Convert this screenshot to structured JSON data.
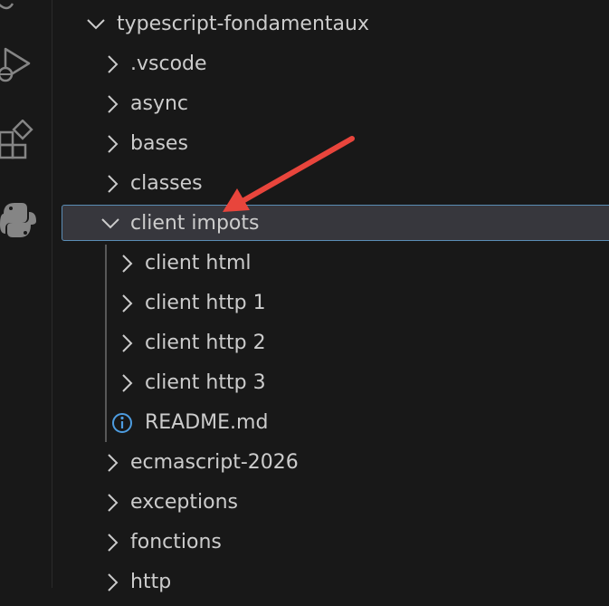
{
  "explorer": {
    "root": {
      "label": "typescript-fondamentaux",
      "expanded": true
    },
    "items": [
      {
        "label": ".vscode",
        "expanded": false
      },
      {
        "label": "async",
        "expanded": false
      },
      {
        "label": "bases",
        "expanded": false
      },
      {
        "label": "classes",
        "expanded": false
      },
      {
        "label": "client impots",
        "expanded": true,
        "selected": true
      },
      {
        "label": "client html",
        "expanded": false
      },
      {
        "label": "client http 1",
        "expanded": false
      },
      {
        "label": "client http 2",
        "expanded": false
      },
      {
        "label": "client http 3",
        "expanded": false
      },
      {
        "label": "README.md",
        "icon": "info-icon"
      },
      {
        "label": "ecmascript-2026",
        "expanded": false
      },
      {
        "label": "exceptions",
        "expanded": false
      },
      {
        "label": "fonctions",
        "expanded": false
      },
      {
        "label": "http",
        "expanded": false
      }
    ]
  },
  "activity_bar": {
    "icons": [
      "run-debug-icon",
      "extensions-icon",
      "python-icon"
    ]
  },
  "annotation": {
    "arrow_color": "#e8453c"
  },
  "colors": {
    "background": "#181818",
    "text": "#cccccc",
    "selection_bg": "#37373d",
    "selection_border": "#5b8db5",
    "info_icon": "#4d9ce0"
  }
}
